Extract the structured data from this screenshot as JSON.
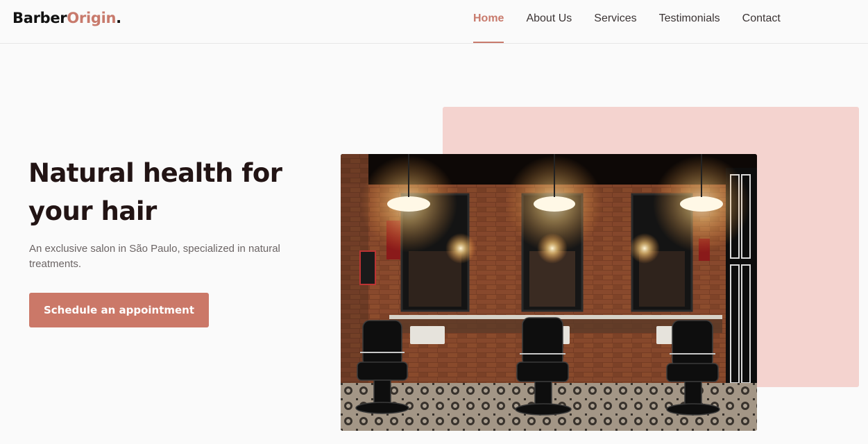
{
  "logo": {
    "part1": "Barber",
    "part2": "Origin",
    "dot": "."
  },
  "nav": {
    "items": [
      {
        "label": "Home",
        "active": true
      },
      {
        "label": "About Us",
        "active": false
      },
      {
        "label": "Services",
        "active": false
      },
      {
        "label": "Testimonials",
        "active": false
      },
      {
        "label": "Contact",
        "active": false
      }
    ]
  },
  "hero": {
    "title": "Natural health for your hair",
    "subtitle": "An exclusive salon in São Paulo, specialized in natural treatments.",
    "cta_label": "Schedule an appointment"
  },
  "colors": {
    "accent": "#c87a6c",
    "button": "#cb7868",
    "pink_panel": "#f4d3cf",
    "title": "#221414"
  },
  "image": {
    "subject": "barbershop-interior-photo"
  }
}
